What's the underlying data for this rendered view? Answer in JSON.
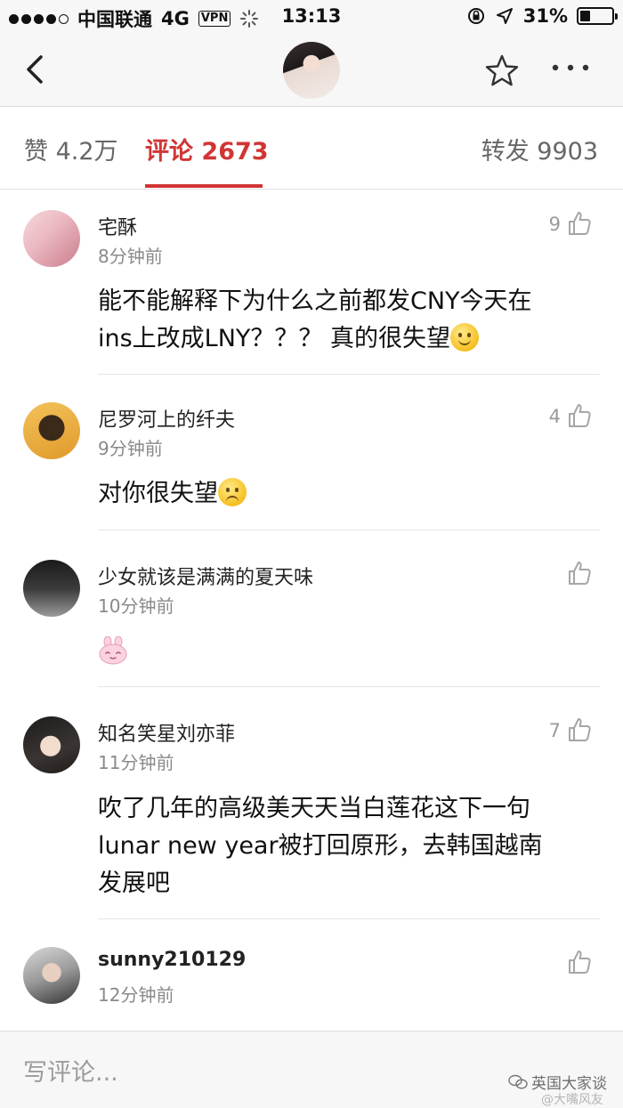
{
  "status_bar": {
    "carrier": "中国联通",
    "network": "4G",
    "vpn": "VPN",
    "time": "13:13",
    "battery": "31%",
    "battery_level": 0.31
  },
  "nav": {
    "back_icon": "chevron-left-icon",
    "avatar_icon": "profile-avatar",
    "star_icon": "star-icon",
    "more_icon": "more-dots-icon"
  },
  "tabs": {
    "likes_label": "赞",
    "likes_count": "4.2万",
    "comments_label": "评论",
    "comments_count": "2673",
    "reposts_label": "转发",
    "reposts_count": "9903"
  },
  "comments": [
    {
      "user": "宅酥",
      "time": "8分钟前",
      "likes": "9",
      "text_line1": "能不能解释下为什么之前都发CNY今天在",
      "text_line2": "ins上改成LNY？？？ 真的很失望",
      "emoji": "smile"
    },
    {
      "user": "尼罗河上的纤夫",
      "time": "9分钟前",
      "likes": "4",
      "text_line1": "对你很失望",
      "emoji": "sad"
    },
    {
      "user": "少女就该是满满的夏天味",
      "time": "10分钟前",
      "likes": "",
      "emoji": "bunny"
    },
    {
      "user": "知名笑星刘亦菲",
      "time": "11分钟前",
      "likes": "7",
      "text_line1": "吹了几年的高级美天天当白莲花这下一句",
      "text_line2": "lunar new year被打回原形，去韩国越南",
      "text_line3": "发展吧"
    },
    {
      "user": "sunny210129",
      "time": "12分钟前",
      "likes": ""
    }
  ],
  "bottom": {
    "placeholder": "写评论...",
    "watermark": "英国大家谈",
    "watermark_sub": "@大嘴风友"
  },
  "colors": {
    "accent": "#d23434",
    "background": "#ffffff",
    "bar": "#f7f7f7"
  }
}
